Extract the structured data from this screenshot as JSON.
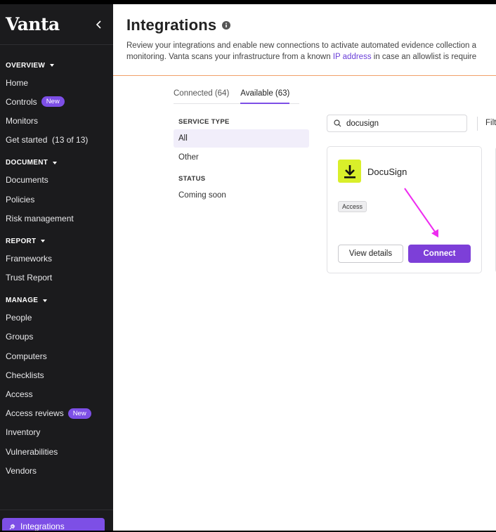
{
  "sidebar": {
    "logo": "Vanta",
    "sections": [
      {
        "title": "OVERVIEW",
        "items": [
          {
            "label": "Home"
          },
          {
            "label": "Controls",
            "badge": "New"
          },
          {
            "label": "Monitors"
          },
          {
            "label": "Get started  (13 of 13)"
          }
        ]
      },
      {
        "title": "DOCUMENT",
        "items": [
          {
            "label": "Documents"
          },
          {
            "label": "Policies"
          },
          {
            "label": "Risk management"
          }
        ]
      },
      {
        "title": "REPORT",
        "items": [
          {
            "label": "Frameworks"
          },
          {
            "label": "Trust Report"
          }
        ]
      },
      {
        "title": "MANAGE",
        "items": [
          {
            "label": "People"
          },
          {
            "label": "Groups"
          },
          {
            "label": "Computers"
          },
          {
            "label": "Checklists"
          },
          {
            "label": "Access"
          },
          {
            "label": "Access reviews",
            "badge": "New"
          },
          {
            "label": "Inventory"
          },
          {
            "label": "Vulnerabilities"
          },
          {
            "label": "Vendors"
          }
        ]
      }
    ],
    "active_item": "Integrations"
  },
  "header": {
    "title": "Integrations",
    "desc_line1": "Review your integrations and enable new connections to activate automated evidence collection a",
    "desc_line2_pre": "monitoring. Vanta scans your infrastructure from a known ",
    "desc_link": "IP address",
    "desc_line2_post": " in case an allowlist is require"
  },
  "tabs": [
    {
      "label": "Connected (64)",
      "active": false
    },
    {
      "label": "Available (63)",
      "active": true
    }
  ],
  "filters": {
    "service_type_heading": "SERVICE TYPE",
    "service_types": [
      {
        "label": "All",
        "selected": true
      },
      {
        "label": "Other",
        "selected": false
      }
    ],
    "status_heading": "STATUS",
    "statuses": [
      {
        "label": "Coming soon"
      }
    ]
  },
  "search": {
    "value": "docusign"
  },
  "filter_button": "Filt",
  "card": {
    "name": "DocuSign",
    "tag": "Access",
    "view_label": "View details",
    "connect_label": "Connect"
  },
  "colors": {
    "accent": "#7d3fd8",
    "sidebar_bg": "#1b1b1d",
    "arrow": "#ee2cf0",
    "logo_bg": "#d9ef2a"
  }
}
